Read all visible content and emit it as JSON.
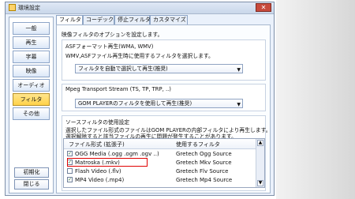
{
  "window": {
    "title": "環境設定",
    "close": "✕"
  },
  "sidebar": {
    "items": [
      {
        "label": "一般"
      },
      {
        "label": "再生"
      },
      {
        "label": "字幕"
      },
      {
        "label": "映像"
      },
      {
        "label": "オーディオ"
      },
      {
        "label": "フィルタ"
      },
      {
        "label": "その他"
      }
    ],
    "buttons": {
      "reset": "初期化",
      "close": "閉じる"
    }
  },
  "tabs": [
    {
      "label": "フィルタ"
    },
    {
      "label": "コーデック"
    },
    {
      "label": "停止フィルタ"
    },
    {
      "label": "カスタマイズ"
    }
  ],
  "content": {
    "intro": "映像フィルタのオプションを設定します。",
    "asf": {
      "legend": "ASFフォーマット再生(WMA, WMV)",
      "desc": "WMV,ASFファイル再生時に使用するフィルタを選択します。",
      "selected": "フィルタを自動で選択して再生(推奨)"
    },
    "mpeg": {
      "legend": "Mpeg Transport Stream (TS, TP, TRP, ..)",
      "selected": "GOM PLAYERのフィルタを使用して再生(推奨)"
    },
    "source": {
      "legend": "ソースフィルタの使用設定",
      "desc1": "選択したファイル形式のファイルはGOM PLAYERの内部フィルタにより再生します。",
      "desc2": "選択解除すると該当ファイルの再生に問題が発生することがあります。"
    },
    "list": {
      "col1": "ファイル形式 (拡張子)",
      "col2": "使用するフィルタ",
      "rows": [
        {
          "check": "✓",
          "name": "OGG Media (.ogg .ogm .ogv ..)",
          "filter": "Gretech Ogg Source"
        },
        {
          "check": "✓",
          "name": "Matroska (.mkv)",
          "filter": "Gretech Mkv Source"
        },
        {
          "check": "",
          "name": "Flash Video (.flv)",
          "filter": "Gretech Flv Source"
        },
        {
          "check": "✓",
          "name": "MP4 Video (.mp4)",
          "filter": "Gretech Mp4 Source"
        }
      ]
    }
  }
}
